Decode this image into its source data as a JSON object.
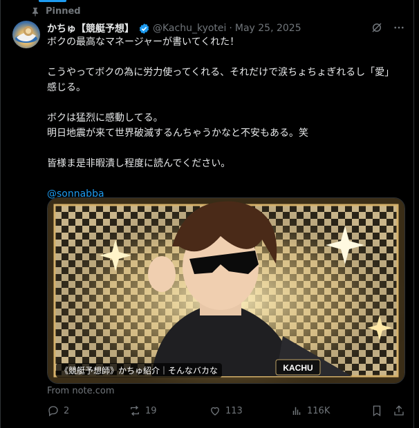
{
  "colors": {
    "accent": "#1d9bf0",
    "muted": "#71767b",
    "text": "#e7e9ea",
    "background": "#000000"
  },
  "pinned_label": "Pinned",
  "author": {
    "display_name": "かちゅ【競艇予想】",
    "handle": "@Kachu_kyotei",
    "separator": "·",
    "date": "May 25, 2025",
    "verified_icon": "verified-badge-icon"
  },
  "tweet": {
    "text": "ボクの最高なマネージャーが書いてくれた！\n\nこうやってボクの為に労力使ってくれる、それだけで涙ちょちょぎれるし「愛」感じる。\n\nボクは猛烈に感動してる。\n明日地震が来て世界破滅するんちゃうかなと不安もある。笑\n\n皆様ま是非暇潰し程度に読んでください。\n\n",
    "mention": "@sonnabba"
  },
  "card": {
    "title": "《競艇予想師》かちゅ紹介｜そんなバカな",
    "badge_text": "KACHU",
    "source": "From note.com"
  },
  "actions": {
    "replies": "2",
    "reposts": "19",
    "likes": "113",
    "views": "116K"
  },
  "icons": [
    "pin-icon",
    "verified-badge-icon",
    "grok-icon",
    "more-icon",
    "reply-icon",
    "repost-icon",
    "like-icon",
    "views-icon",
    "bookmark-icon",
    "share-icon"
  ]
}
